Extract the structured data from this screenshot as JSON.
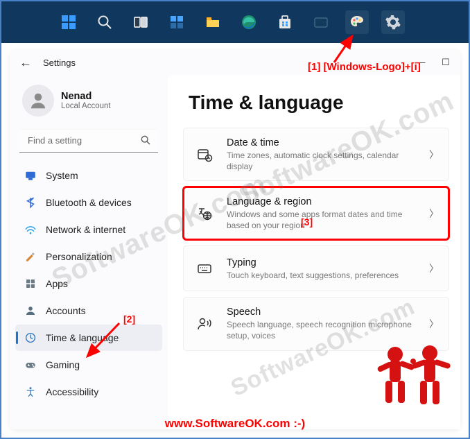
{
  "taskbar": {
    "items": [
      "start",
      "search",
      "task-view",
      "widgets",
      "file-explorer",
      "edge",
      "store",
      "mail",
      "paint",
      "settings"
    ]
  },
  "window": {
    "back": "←",
    "title": "Settings",
    "controls": {
      "min": "—",
      "max": "☐"
    }
  },
  "profile": {
    "name": "Nenad",
    "sub": "Local Account"
  },
  "search": {
    "placeholder": "Find a setting"
  },
  "sidebar": {
    "items": [
      {
        "key": "system",
        "label": "System"
      },
      {
        "key": "bluetooth",
        "label": "Bluetooth & devices"
      },
      {
        "key": "network",
        "label": "Network & internet"
      },
      {
        "key": "personalization",
        "label": "Personalization"
      },
      {
        "key": "apps",
        "label": "Apps"
      },
      {
        "key": "accounts",
        "label": "Accounts"
      },
      {
        "key": "time-language",
        "label": "Time & language"
      },
      {
        "key": "gaming",
        "label": "Gaming"
      },
      {
        "key": "accessibility",
        "label": "Accessibility"
      }
    ],
    "selected": "time-language"
  },
  "page": {
    "title": "Time & language"
  },
  "cards": [
    {
      "key": "date-time",
      "title": "Date & time",
      "desc": "Time zones, automatic clock settings, calendar display"
    },
    {
      "key": "lang-region",
      "title": "Language & region",
      "desc": "Windows and some apps format dates and time based on your region",
      "highlight": true
    },
    {
      "key": "typing",
      "title": "Typing",
      "desc": "Touch keyboard, text suggestions, preferences"
    },
    {
      "key": "speech",
      "title": "Speech",
      "desc": "Speech language, speech recognition microphone setup, voices"
    }
  ],
  "annotations": {
    "a1": "[1]  [Windows-Logo]+[i]",
    "a2": "[2]",
    "a3": "[3]",
    "footer": "www.SoftwareOK.com :-)",
    "watermark": "SoftwareOK.com"
  }
}
